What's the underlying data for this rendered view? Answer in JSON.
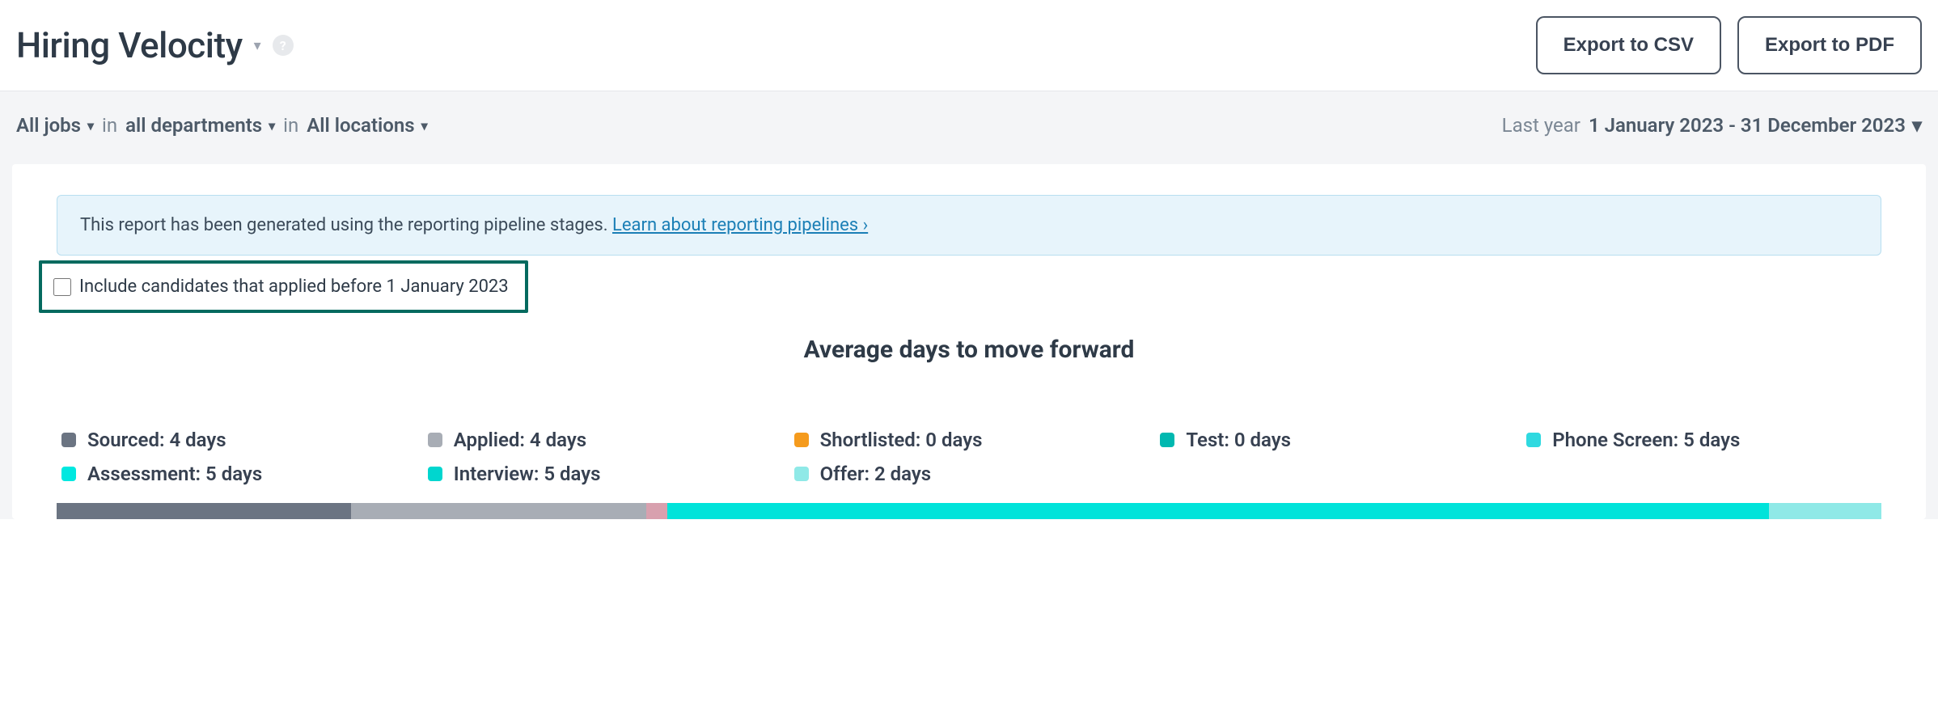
{
  "header": {
    "title": "Hiring Velocity",
    "export_csv": "Export to CSV",
    "export_pdf": "Export to PDF"
  },
  "filters": {
    "jobs": "All jobs",
    "in1": "in",
    "departments": "all departments",
    "in2": "in",
    "locations": "All locations",
    "period_label": "Last year",
    "date_range": "1 January 2023 - 31 December 2023"
  },
  "banner": {
    "text": "This report has been generated using the reporting pipeline stages. ",
    "link": "Learn about reporting pipelines ›"
  },
  "checkbox": {
    "label": "Include candidates that applied before 1 January 2023"
  },
  "chart_data": {
    "type": "bar",
    "title": "Average days to move forward",
    "unit": "days",
    "series": [
      {
        "name": "Sourced",
        "label": "Sourced: 4 days",
        "value": 4,
        "color": "#6b7482"
      },
      {
        "name": "Applied",
        "label": "Applied: 4 days",
        "value": 4,
        "color": "#a8adb5"
      },
      {
        "name": "Shortlisted",
        "label": "Shortlisted: 0 days",
        "value": 0,
        "color": "#f59b1d"
      },
      {
        "name": "Test",
        "label": "Test: 0 days",
        "value": 0,
        "color": "#00b8b0"
      },
      {
        "name": "Phone Screen",
        "label": "Phone Screen: 5 days",
        "value": 5,
        "color": "#2fd9e0"
      },
      {
        "name": "Assessment",
        "label": "Assessment: 5 days",
        "value": 5,
        "color": "#00e8e0"
      },
      {
        "name": "Interview",
        "label": "Interview: 5 days",
        "value": 5,
        "color": "#00d6cf"
      },
      {
        "name": "Offer",
        "label": "Offer: 2 days",
        "value": 2,
        "color": "#8fe9e7"
      }
    ],
    "bar_segments": [
      {
        "color": "#6b7482",
        "flex": 4.2
      },
      {
        "color": "#a8adb5",
        "flex": 4.2
      },
      {
        "color": "#d8a0ae",
        "flex": 0.3
      },
      {
        "color": "#00e3da",
        "flex": 15.7
      },
      {
        "color": "#8fe9e7",
        "flex": 1.6
      }
    ]
  }
}
